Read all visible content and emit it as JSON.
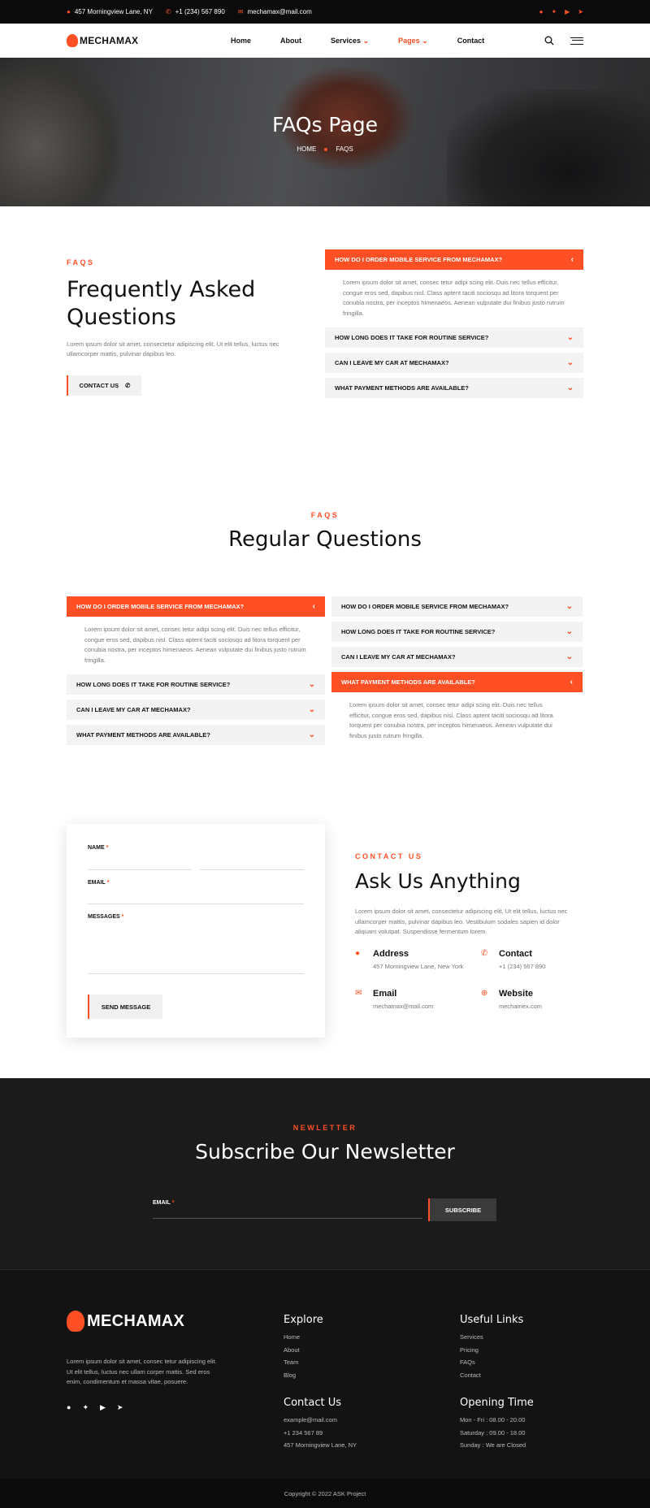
{
  "topbar": {
    "address": "457 Morningview Lane, NY",
    "phone": "+1 (234) 567 890",
    "email": "mechamax@mail.com"
  },
  "nav": {
    "logo": "MECHAMAX",
    "items": [
      "Home",
      "About",
      "Services",
      "Pages",
      "Contact"
    ]
  },
  "hero": {
    "title": "FAQs Page",
    "crumb_home": "HOME",
    "crumb_current": "FAQS"
  },
  "faq1": {
    "eyebrow": "FAQS",
    "title": "Frequently Asked Questions",
    "desc": "Lorem ipsum dolor sit amet, consectetur adipiscing elit. Ut elit tellus, luctus nec ullamcorper mattis, pulvinar dapibus leo.",
    "button": "CONTACT US",
    "items": [
      {
        "q": "HOW DO I ORDER MOBILE SERVICE FROM MECHAMAX?",
        "a": "Lorem ipsum dolor sit amet, consec tetur adipi scing elit. Duis nec tellus efficitur, congue eros sed, dapibus nisl. Class aptent taciti sociosqu ad litora torquent per conubia nostra, per inceptos himenaeos. Aenean vulputate dui finibus justo rutrum fringilla."
      },
      {
        "q": "HOW LONG DOES IT TAKE FOR ROUTINE SERVICE?"
      },
      {
        "q": "CAN I LEAVE MY CAR AT MECHAMAX?"
      },
      {
        "q": "WHAT PAYMENT METHODS ARE AVAILABLE?"
      }
    ]
  },
  "faq2": {
    "eyebrow": "FAQS",
    "title": "Regular Questions",
    "left": [
      {
        "q": "HOW DO I ORDER MOBILE SERVICE FROM MECHAMAX?",
        "a": "Lorem ipsum dolor sit amet, consec tetur adipi scing elit. Duis nec tellus efficitur, congue eros sed, dapibus nisl. Class aptent taciti sociosqu ad litora torquent per conubia nostra, per inceptos himenaeos. Aenean vulputate dui finibus justo rutrum fringilla."
      },
      {
        "q": "HOW LONG DOES IT TAKE FOR ROUTINE SERVICE?"
      },
      {
        "q": "CAN I LEAVE MY CAR AT MECHAMAX?"
      },
      {
        "q": "WHAT PAYMENT METHODS ARE AVAILABLE?"
      }
    ],
    "right": [
      {
        "q": "HOW DO I ORDER MOBILE SERVICE FROM MECHAMAX?"
      },
      {
        "q": "HOW LONG DOES IT TAKE FOR ROUTINE SERVICE?"
      },
      {
        "q": "CAN I LEAVE MY CAR AT MECHAMAX?"
      },
      {
        "q": "WHAT PAYMENT METHODS ARE AVAILABLE?",
        "a": "Lorem ipsum dolor sit amet, consec tetur adipi scing elit. Duis nec tellus efficitur, congue eros sed, dapibus nisl. Class aptent taciti sociosqu ad litora torquent per conubia nostra, per inceptos himenaeos. Aenean vulputate dui finibus justo rutrum fringilla."
      }
    ]
  },
  "contact": {
    "form": {
      "name": "NAME",
      "email": "EMAIL",
      "messages": "MESSAGES",
      "required": "*",
      "button": "SEND MESSAGE"
    },
    "eyebrow": "CONTACT US",
    "title": "Ask Us Anything",
    "desc": "Lorem ipsum dolor sit amet, consectetur adipiscing elit. Ut elit tellus, luctus nec ullamcorper mattis, pulvinar dapibus leo. Vestibulum sodales sapien id dolor aliquam volutpat. Suspendisse fermentum lorem.",
    "info": {
      "address_t": "Address",
      "address_v": "457 Morningview Lane, New York",
      "contact_t": "Contact",
      "contact_v": "+1 (234) 567 890",
      "email_t": "Email",
      "email_v": "mechamax@mail.com",
      "website_t": "Website",
      "website_v": "mechamex.com"
    }
  },
  "newsletter": {
    "eyebrow": "NEWLETTER",
    "title": "Subscribe Our Newsletter",
    "label": "EMAIL",
    "required": "*",
    "button": "SUBSCRIBE"
  },
  "footer": {
    "logo": "MECHAMAX",
    "desc": "Lorem ipsum dolor sit amet, consec tetur adipiscing elit. Ut elit tellus, luctus nec ullam corper mattis. Sed eros enim, condimentum et massa vitae, posuere.",
    "explore": {
      "title": "Explore",
      "items": [
        "Home",
        "About",
        "Team",
        "Blog"
      ]
    },
    "useful": {
      "title": "Useful Links",
      "items": [
        "Services",
        "Pricing",
        "FAQs",
        "Contact"
      ]
    },
    "contact": {
      "title": "Contact Us",
      "items": [
        "example@mail.com",
        "+1 234 567 89",
        "457 Morningview Lane, NY"
      ]
    },
    "hours": {
      "title": "Opening Time",
      "items": [
        "Mon - Fri : 08.00 - 20.00",
        "Saturday : 09.00 - 18.00",
        "Sunday : We are Closed"
      ]
    },
    "copyright": "Copyright © 2022 ASK Project"
  },
  "colors": {
    "accent": "#ff4f24",
    "dark": "#1b1b1b"
  }
}
